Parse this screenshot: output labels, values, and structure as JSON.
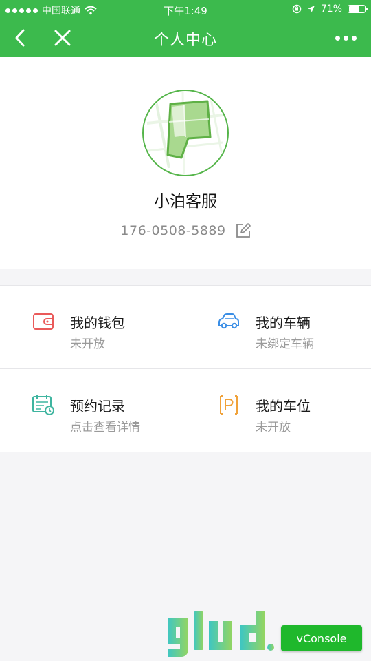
{
  "status_bar": {
    "carrier": "中国联通",
    "time": "下午1:49",
    "battery": "71%",
    "battery_level": 0.71
  },
  "nav": {
    "title": "个人中心"
  },
  "profile": {
    "name": "小泊客服",
    "phone": "176-0508-5889"
  },
  "menu": [
    {
      "title": "我的钱包",
      "subtitle": "未开放",
      "icon": "wallet-icon",
      "color": "#ea5a5a"
    },
    {
      "title": "我的车辆",
      "subtitle": "未绑定车辆",
      "icon": "car-icon",
      "color": "#3a8ee6"
    },
    {
      "title": "预约记录",
      "subtitle": "点击查看详情",
      "icon": "calendar-icon",
      "color": "#3fb5a0"
    },
    {
      "title": "我的车位",
      "subtitle": "未开放",
      "icon": "parking-icon",
      "color": "#f0a23a"
    }
  ],
  "vconsole": {
    "label": "vConsole"
  },
  "colors": {
    "brand_green": "#3cba4d",
    "vconsole_green": "#1fb82c"
  }
}
